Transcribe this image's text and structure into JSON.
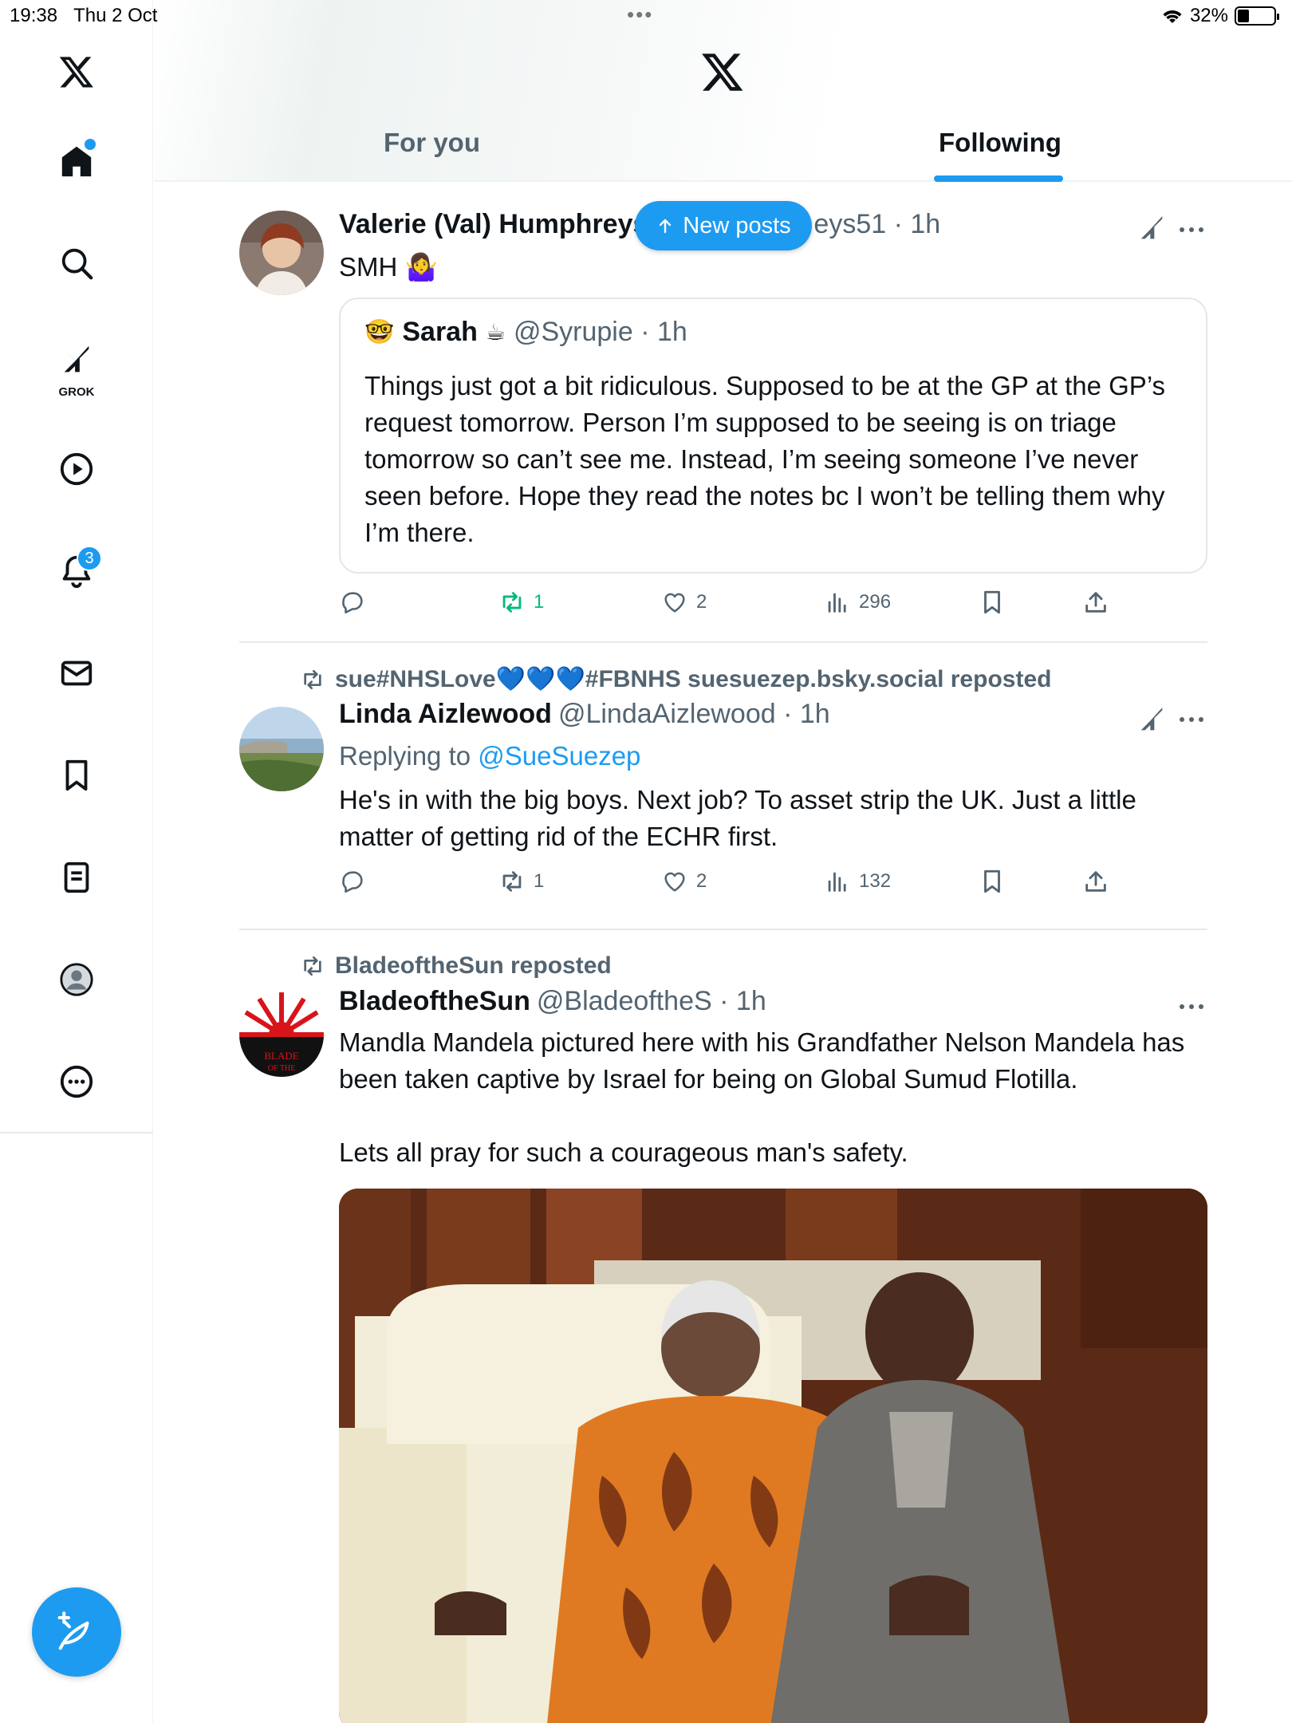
{
  "status": {
    "time": "19:38",
    "date": "Thu 2 Oct",
    "battery": "32%",
    "battery_level": 0.32
  },
  "header": {
    "tabs": [
      {
        "label": "For you"
      },
      {
        "label": "Following"
      }
    ],
    "active_tab": "Following"
  },
  "sidebar": {
    "items": [
      {
        "name": "home"
      },
      {
        "name": "explore"
      },
      {
        "name": "grok",
        "label": "GROK"
      },
      {
        "name": "video"
      },
      {
        "name": "notifications",
        "badge": "3"
      },
      {
        "name": "messages"
      },
      {
        "name": "bookmarks"
      },
      {
        "name": "lists"
      },
      {
        "name": "profile"
      },
      {
        "name": "more"
      }
    ]
  },
  "new_posts": {
    "label": "New posts"
  },
  "posts": [
    {
      "name": "Valerie (Val) Humphreys",
      "handle_visible": "eys51",
      "time": "1h",
      "text": "SMH 🤷‍♀️",
      "quote": {
        "emoji": "🤓",
        "name": "Sarah",
        "name_emoji": "☕",
        "handle": "@Syrupie",
        "time": "1h",
        "text": "Things just got a bit ridiculous. Supposed to be at the GP at the GP’s request tomorrow. Person I’m supposed to be seeing is on triage tomorrow so can’t see me. Instead, I’m seeing someone I’ve never seen before. Hope they read the notes bc I won’t be telling them why I’m there."
      },
      "actions": {
        "replies": "",
        "reposts": "1",
        "likes": "2",
        "views": "296"
      },
      "reposted": true
    },
    {
      "reposted_by": "sue#NHSLove💙💙💙#FBNHS suesuezep.bsky.social reposted",
      "name": "Linda Aizlewood",
      "handle": "@LindaAizlewood",
      "time": "1h",
      "replying_prefix": "Replying to ",
      "replying_to": "@SueSuezep",
      "text": "He's in with the big boys. Next job? To asset strip the UK. Just a little matter of getting rid of the ECHR first.",
      "actions": {
        "replies": "",
        "reposts": "1",
        "likes": "2",
        "views": "132"
      }
    },
    {
      "reposted_by": "BladeoftheSun reposted",
      "name": "BladeoftheSun",
      "handle": "@BladeoftheS",
      "time": "1h",
      "text_line1": "Mandla Mandela pictured here with his Grandfather Nelson Mandela has been taken captive by Israel for being on Global Sumud Flotilla.",
      "text_line2": "Lets all pray for such a courageous man's safety."
    }
  ],
  "colors": {
    "accent": "#1d9bf0",
    "repost_green": "#00ba7c",
    "secondary_text": "#536471"
  }
}
